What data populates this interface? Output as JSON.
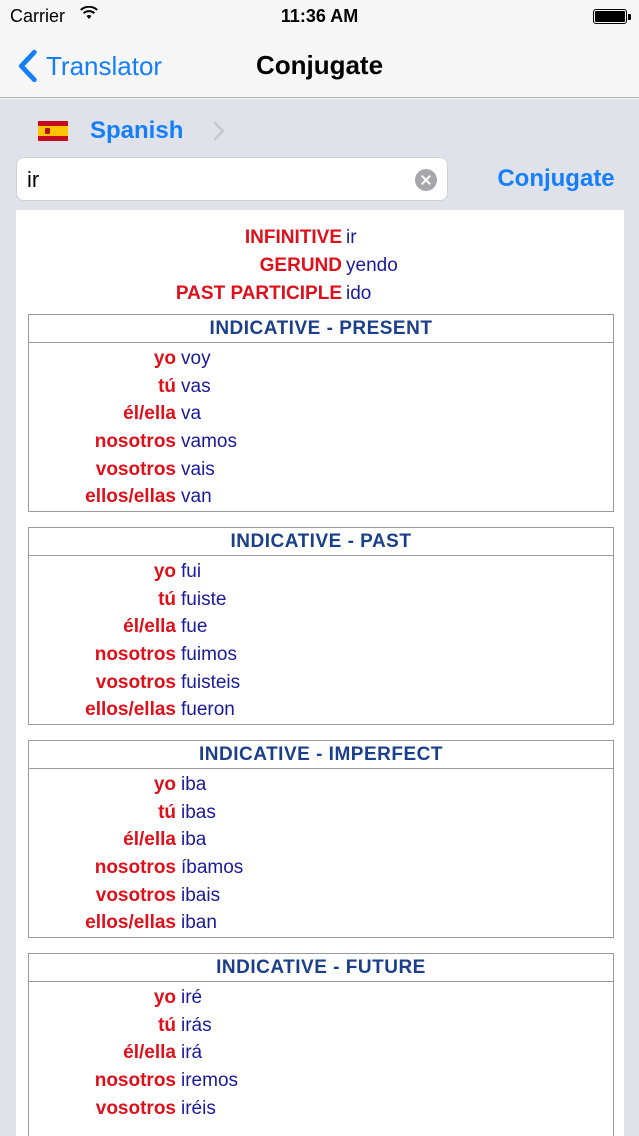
{
  "status_bar": {
    "carrier": "Carrier",
    "time": "11:36 AM"
  },
  "nav": {
    "back_label": "Translator",
    "title": "Conjugate"
  },
  "language": {
    "label": "Spanish",
    "flag": "es-flag-icon"
  },
  "search": {
    "value": "ir",
    "placeholder": ""
  },
  "conjugate_button": "Conjugate",
  "verb_forms": [
    {
      "label": "INFINITIVE",
      "value": "ir"
    },
    {
      "label": "GERUND",
      "value": "yendo"
    },
    {
      "label": "PAST PARTICIPLE",
      "value": "ido"
    }
  ],
  "tenses": [
    {
      "name": "INDICATIVE - PRESENT",
      "rows": [
        {
          "pronoun": "yo",
          "form": "voy"
        },
        {
          "pronoun": "tú",
          "form": "vas"
        },
        {
          "pronoun": "él/ella",
          "form": "va"
        },
        {
          "pronoun": "nosotros",
          "form": "vamos"
        },
        {
          "pronoun": "vosotros",
          "form": "vais"
        },
        {
          "pronoun": "ellos/ellas",
          "form": "van"
        }
      ]
    },
    {
      "name": "INDICATIVE - PAST",
      "rows": [
        {
          "pronoun": "yo",
          "form": "fui"
        },
        {
          "pronoun": "tú",
          "form": "fuiste"
        },
        {
          "pronoun": "él/ella",
          "form": "fue"
        },
        {
          "pronoun": "nosotros",
          "form": "fuimos"
        },
        {
          "pronoun": "vosotros",
          "form": "fuisteis"
        },
        {
          "pronoun": "ellos/ellas",
          "form": "fueron"
        }
      ]
    },
    {
      "name": "INDICATIVE - IMPERFECT",
      "rows": [
        {
          "pronoun": "yo",
          "form": "iba"
        },
        {
          "pronoun": "tú",
          "form": "ibas"
        },
        {
          "pronoun": "él/ella",
          "form": "iba"
        },
        {
          "pronoun": "nosotros",
          "form": "íbamos"
        },
        {
          "pronoun": "vosotros",
          "form": "ibais"
        },
        {
          "pronoun": "ellos/ellas",
          "form": "iban"
        }
      ]
    },
    {
      "name": "INDICATIVE - FUTURE",
      "rows": [
        {
          "pronoun": "yo",
          "form": "iré"
        },
        {
          "pronoun": "tú",
          "form": "irás"
        },
        {
          "pronoun": "él/ella",
          "form": "irá"
        },
        {
          "pronoun": "nosotros",
          "form": "iremos"
        },
        {
          "pronoun": "vosotros",
          "form": "iréis"
        }
      ]
    }
  ],
  "colors": {
    "accent": "#147efb",
    "pronoun": "#e0101b",
    "form": "#1a1a9a",
    "tense_header": "#1b3f8a"
  }
}
